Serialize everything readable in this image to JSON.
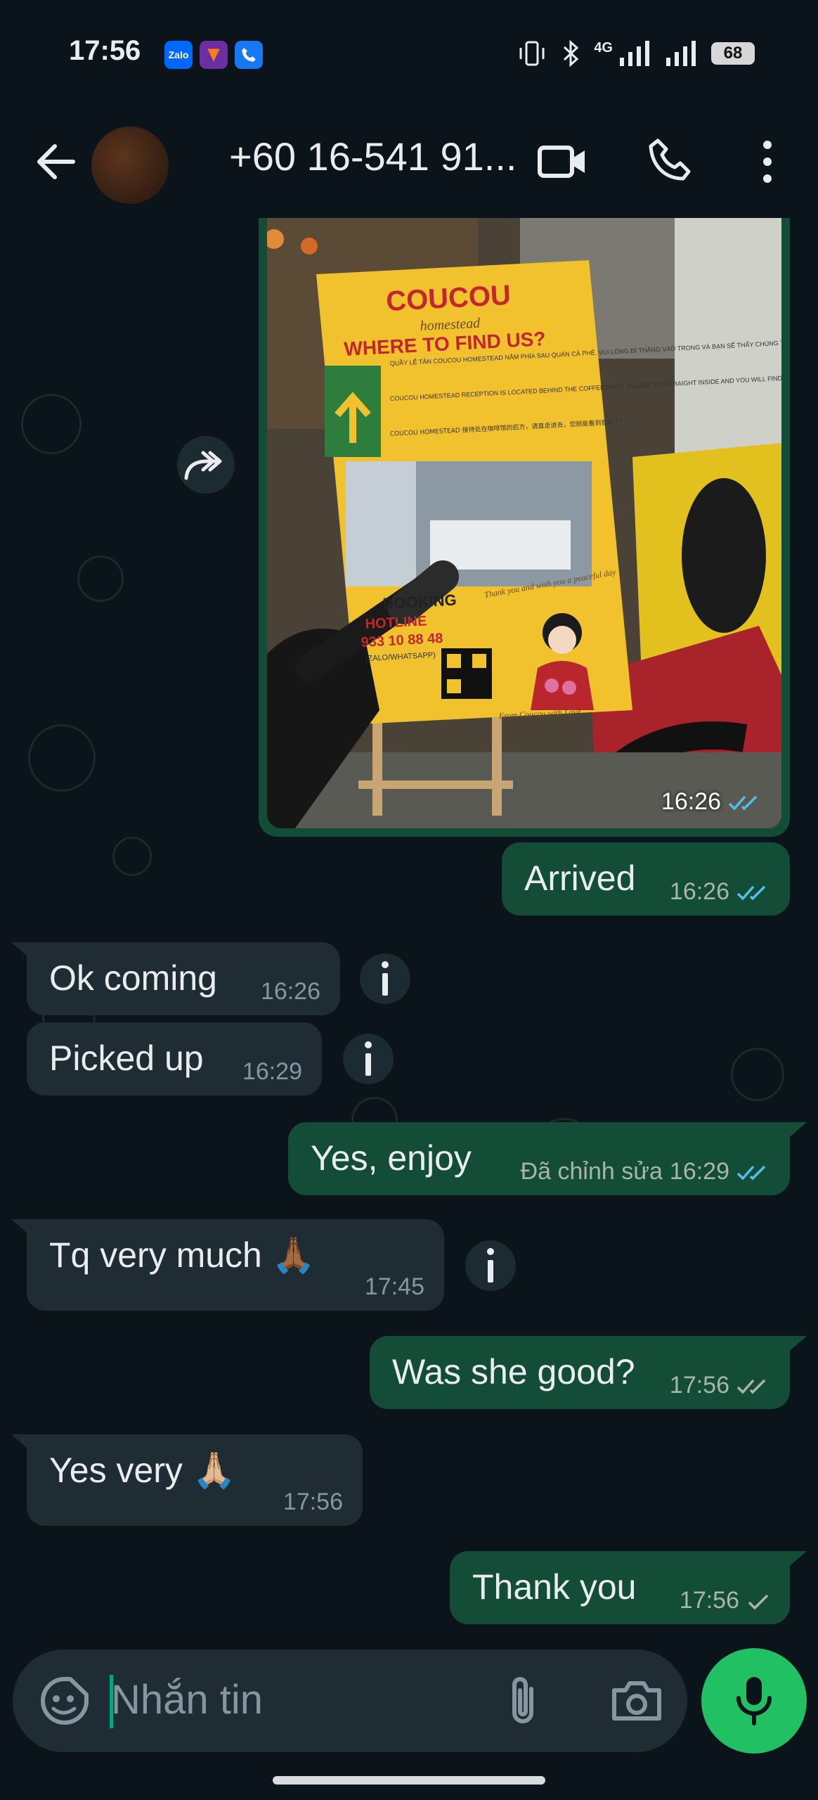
{
  "status_bar": {
    "time": "17:56",
    "app_icons": [
      "Zalo",
      "shield-app",
      "phone-app"
    ],
    "network": "4G",
    "battery": "68"
  },
  "header": {
    "contact": "+60 16-541 91...",
    "icons": [
      "back-arrow-icon",
      "video-call-icon",
      "voice-call-icon",
      "more-vert-icon"
    ]
  },
  "messages": {
    "image_time": "16:26",
    "arrived": {
      "text": "Arrived",
      "time": "16:26"
    },
    "ok_coming": {
      "text": "Ok coming",
      "time": "16:26"
    },
    "picked_up": {
      "text": "Picked up",
      "time": "16:29"
    },
    "yes_enjoy": {
      "text": "Yes, enjoy",
      "edited": "Đã chỉnh sửa",
      "time": "16:29"
    },
    "tq": {
      "text": "Tq very much 🙏🏾",
      "time": "17:45"
    },
    "was_she": {
      "text": "Was she good?",
      "time": "17:56"
    },
    "yes_very": {
      "text": "Yes very 🙏🏼",
      "time": "17:56"
    },
    "thank_you": {
      "text": "Thank you",
      "time": "17:56"
    }
  },
  "sign": {
    "brand": "COUCOU",
    "sub": "homestead",
    "heading": "WHERE TO FIND US?",
    "vn": "QUẦY LỄ TÂN COUCOU HOMESTEAD NẰM PHÍA SAU QUÁN CÀ PHÊ. VUI LÒNG ĐI THẲNG VÀO TRONG VÀ BẠN SẼ THẤY CHÚNG TÔI NGAY!",
    "en": "COUCOU HOMESTEAD RECEPTION IS LOCATED BEHIND THE COFFEE SHOP. PLEASE GO STRAIGHT INSIDE AND YOU WILL FIND US!",
    "cn": "COUCOU HOMESTEAD 接待处在咖啡馆的后方，请直走进去，您就能看到我们了！",
    "booking": "BOOKING",
    "hotline": "HOTLINE",
    "phone": "933 10 88 48",
    "zalo": "(ZALO/WHATSAPP)",
    "note": "Thank you and wish you a peaceful day",
    "from": "From Coucou with Love"
  },
  "composer": {
    "placeholder": "Nhắn tin"
  },
  "colors": {
    "background": "#0b141a",
    "outgoing": "#144d37",
    "incoming": "#202c33",
    "read_tick": "#53bdeb",
    "mic": "#21c063"
  }
}
